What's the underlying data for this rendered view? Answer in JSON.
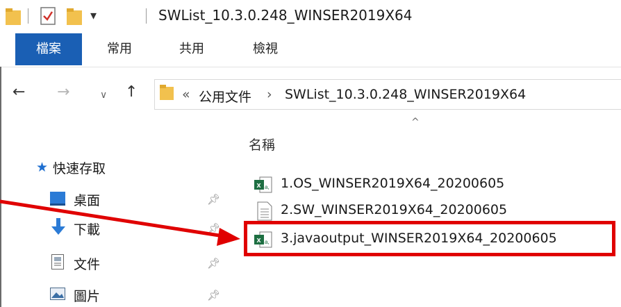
{
  "window": {
    "title": "SWList_10.3.0.248_WINSER2019X64",
    "quick_access_dropdown": "▾"
  },
  "ribbon": {
    "tabs": [
      {
        "label": "檔案",
        "active": true
      },
      {
        "label": "常用"
      },
      {
        "label": "共用"
      },
      {
        "label": "檢視"
      }
    ]
  },
  "address_bar": {
    "breadcrumb_overflow": "«",
    "path": [
      "公用文件",
      "SWList_10.3.0.248_WINSER2019X64"
    ],
    "separator": "›"
  },
  "nav_pane": {
    "quick_access_label": "快速存取",
    "items": [
      {
        "label": "桌面",
        "icon": "desktop-icon",
        "pinned": true
      },
      {
        "label": "下載",
        "icon": "download-icon",
        "pinned": true
      },
      {
        "label": "文件",
        "icon": "documents-icon",
        "pinned": true
      },
      {
        "label": "圖片",
        "icon": "pictures-icon",
        "pinned": true
      }
    ]
  },
  "file_list": {
    "column_header": "名稱",
    "sort_indicator": "^",
    "files": [
      {
        "name": "1.OS_WINSER2019X64_20200605",
        "icon": "excel-csv-icon"
      },
      {
        "name": "2.SW_WINSER2019X64_20200605",
        "icon": "text-file-icon"
      },
      {
        "name": "3.javaoutput_WINSER2019X64_20200605",
        "icon": "excel-csv-icon",
        "highlighted": true
      }
    ]
  },
  "colors": {
    "accent": "#1a5fb4",
    "highlight_box": "#e00000",
    "folder": "#f2c14e",
    "excel": "#1d6f42"
  }
}
